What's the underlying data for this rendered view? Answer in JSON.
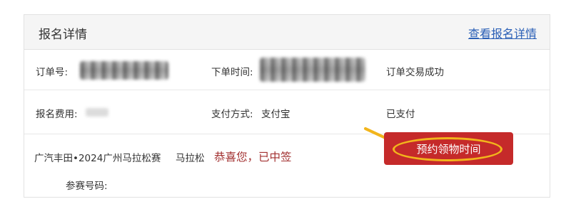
{
  "header": {
    "title": "报名详情",
    "detail_link": "查看报名详情"
  },
  "order": {
    "order_no_label": "订单号:",
    "order_time_label": "下单时间:",
    "status": "订单交易成功",
    "fee_label": "报名费用:",
    "payment_label": "支付方式:",
    "payment_value": "支付宝",
    "payment_status": "已支付"
  },
  "event": {
    "name": "广汽丰田•2024广州马拉松赛",
    "category": "马拉松",
    "result": "恭喜您，已中签",
    "bib_label": "参赛号码:",
    "pickup_button": "预约领物时间"
  },
  "colors": {
    "accent_red": "#c52a2a",
    "highlight_yellow": "#f2b51c",
    "link_blue": "#2a5fb6"
  }
}
